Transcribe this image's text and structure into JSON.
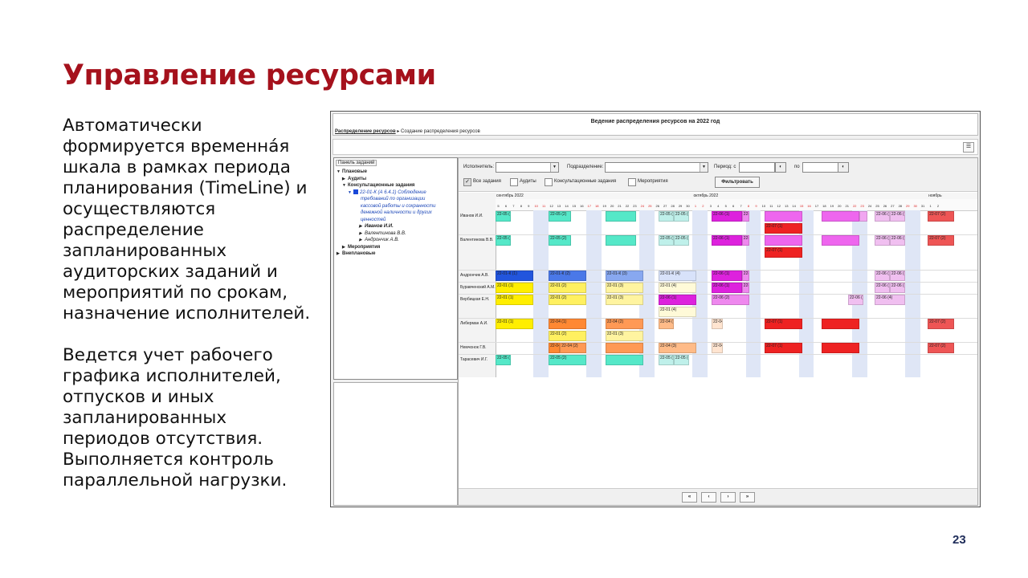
{
  "slide": {
    "title": "Управление ресурсами",
    "para1": [
      "Автоматически",
      "формируется временна́я",
      "шкала в рамках периода",
      "планирования (TimeLine) и",
      "осуществляются",
      "распределение",
      "запланированных",
      "аудиторских заданий и",
      "мероприятий по срокам,",
      "назначение исполнителей."
    ],
    "para2": [
      "Ведется учет рабочего",
      "графика исполнителей,",
      "отпусков и иных",
      "запланированных",
      "периодов отсутствия.",
      "Выполняется контроль",
      "параллельной нагрузки."
    ],
    "page_number": "23"
  },
  "app": {
    "title": "Ведение распределения ресурсов на 2022 год",
    "breadcrumb_link": "Распределение ресурсов",
    "breadcrumb_sep": "▸",
    "breadcrumb_current": "Создание распределения ресурсов",
    "menu_icon": "list-icon"
  },
  "tree": {
    "header": "Панель заданий",
    "planned": "Плановые",
    "audits": "Аудиты",
    "consult": "Консультационные задания",
    "task_lines": [
      "22-01-К (А 6.4.1) Соблюдение",
      "требований по организации",
      "кассовой работы и сохранности",
      "денежной наличности и других",
      "ценностей"
    ],
    "people": [
      "Иванов И.И.",
      "Валентинова В.В.",
      "Андрончик А.В."
    ],
    "events": "Мероприятия",
    "unplanned": "Внеплановые"
  },
  "filters": {
    "executor_label": "Исполнитель:",
    "dept_label": "Подразделение:",
    "period_from_label": "Период: с",
    "period_to_label": "по",
    "checkboxes": [
      "Все задания",
      "Аудиты",
      "Консультационные задания",
      "Мероприятия"
    ],
    "all_checked": "✓",
    "filter_button": "Фильтровать"
  },
  "timeline": {
    "months": [
      "сентябрь 2022",
      "октябрь 2022",
      "ноябрь"
    ],
    "day_numbers": [
      "5",
      "6",
      "7",
      "8",
      "9",
      "10",
      "11",
      "12",
      "13",
      "14",
      "15",
      "16",
      "17",
      "18",
      "19",
      "20",
      "21",
      "22",
      "23",
      "24",
      "25",
      "26",
      "27",
      "28",
      "29",
      "30",
      "1",
      "2",
      "3",
      "4",
      "5",
      "6",
      "7",
      "8",
      "9",
      "10",
      "11",
      "12",
      "13",
      "14",
      "15",
      "16",
      "17",
      "18",
      "19",
      "20",
      "21",
      "22",
      "23",
      "24",
      "25",
      "26",
      "27",
      "28",
      "29",
      "30",
      "31",
      "1",
      "2"
    ],
    "rows": [
      {
        "name": "Иванов И.И.",
        "bars": [
          [
            "22-05 (1)",
            "#55e8c8",
            0,
            4
          ],
          [
            "22-05 (2)",
            "#55e8c8",
            14,
            20
          ],
          [
            "",
            "#55e8c8",
            29,
            37
          ],
          [
            "22-05 (3)",
            "#bff0ea",
            43,
            47
          ],
          [
            "22-05 (4)",
            "#bff0ea",
            47,
            51
          ],
          [
            "22-06 (1)",
            "#dd22dd",
            57,
            65
          ],
          [
            "22-0",
            "#ee88ee",
            65,
            67
          ],
          [
            "",
            "#ee66ee",
            71,
            81
          ],
          [
            "",
            "#ee66ee",
            86,
            96
          ],
          [
            "",
            "#f1a6f1",
            96,
            98
          ],
          [
            "22-06 (3)",
            "#f0bff0",
            100,
            104
          ],
          [
            "22-06 (4)",
            "#f0bff0",
            104,
            108
          ],
          [
            "22-07 (2)",
            "#ee5555",
            114,
            121
          ]
        ]
      },
      {
        "name": "",
        "bars": [
          [
            "22-07 (1)",
            "#ee2222",
            71,
            81
          ]
        ]
      },
      {
        "name": "Валентинова В.В.",
        "bars": [
          [
            "22-05 (1)",
            "#55e8c8",
            0,
            4
          ],
          [
            "22-05 (2)",
            "#55e8c8",
            14,
            20
          ],
          [
            "",
            "#55e8c8",
            29,
            37
          ],
          [
            "22-05 (3)",
            "#bff0ea",
            43,
            47
          ],
          [
            "22-05 (4)",
            "#bff0ea",
            47,
            51
          ],
          [
            "22-06 (1)",
            "#dd22dd",
            57,
            65
          ],
          [
            "22-0",
            "#ee88ee",
            65,
            67
          ],
          [
            "",
            "#ee66ee",
            71,
            81
          ],
          [
            "",
            "#ee66ee",
            86,
            96
          ],
          [
            "22-06 (3)",
            "#f0bff0",
            100,
            104
          ],
          [
            "22-06 (4)",
            "#f0bff0",
            104,
            108
          ],
          [
            "22-07 (2)",
            "#ee5555",
            114,
            121
          ]
        ]
      },
      {
        "name": "",
        "bars": [
          [
            "22-07 (1)",
            "#ee2222",
            71,
            81
          ]
        ]
      },
      {
        "name": "Андрончик А.В.",
        "bars": [
          [
            "22-01-К (1)",
            "#2255dd",
            0,
            10
          ],
          [
            "22-01-К (2)",
            "#4a78e8",
            14,
            24
          ],
          [
            "22-01-К (3)",
            "#88a8f0",
            29,
            39
          ],
          [
            "22-01-К (4)",
            "#d8e2fa",
            43,
            53
          ],
          [
            "22-06 (1)",
            "#dd22dd",
            57,
            65
          ],
          [
            "22-0",
            "#ee88ee",
            65,
            67
          ],
          [
            "22-06 (3)",
            "#f0bff0",
            100,
            104
          ],
          [
            "22-06 (4)",
            "#f0bff0",
            104,
            108
          ]
        ]
      },
      {
        "name": "Буравченский А.М.",
        "bars": [
          [
            "22-01 (1)",
            "#ffee00",
            0,
            10
          ],
          [
            "22-01 (2)",
            "#fff060",
            14,
            24
          ],
          [
            "22-01 (3)",
            "#fff4a0",
            29,
            39
          ],
          [
            "22-01 (4)",
            "#fffad8",
            43,
            53
          ],
          [
            "22-06 (1)",
            "#dd22dd",
            57,
            65
          ],
          [
            "22-0",
            "#ee88ee",
            65,
            67
          ],
          [
            "22-06 (3)",
            "#f0bff0",
            100,
            104
          ],
          [
            "22-06 (4)",
            "#f0bff0",
            104,
            108
          ]
        ]
      },
      {
        "name": "Вербицкая Е.Н.",
        "bars": [
          [
            "22-01 (1)",
            "#ffee00",
            0,
            10
          ],
          [
            "22-01 (2)",
            "#fff060",
            14,
            24
          ],
          [
            "22-01 (3)",
            "#fff4a0",
            29,
            39
          ],
          [
            "22-06 (1)",
            "#dd22dd",
            43,
            53
          ],
          [
            "22-06 (2)",
            "#ee88ee",
            57,
            67
          ],
          [
            "22-06 (3)",
            "#f0bff0",
            93,
            97
          ],
          [
            "22-06 (4)",
            "#f0bff0",
            100,
            108
          ]
        ]
      },
      {
        "name": "",
        "bars": [
          [
            "22-01 (4)",
            "#fffad8",
            43,
            53
          ]
        ]
      },
      {
        "name": "Либерман А.И.",
        "bars": [
          [
            "22-01 (1)",
            "#ffee00",
            0,
            10
          ],
          [
            "22-04 (1)",
            "#ff8833",
            14,
            24
          ],
          [
            "22-04 (2)",
            "#ff9955",
            29,
            39
          ],
          [
            "22-04 (3)",
            "#ffbb88",
            43,
            47
          ],
          [
            "22-04 (4)",
            "#ffe4d0",
            57,
            60
          ],
          [
            "22-07 (1)",
            "#ee2222",
            71,
            81
          ],
          [
            "",
            "#ee2222",
            86,
            96
          ],
          [
            "22-07 (2)",
            "#ee5555",
            114,
            121
          ]
        ]
      },
      {
        "name": "",
        "bars": [
          [
            "22-01 (2)",
            "#fff060",
            14,
            24
          ],
          [
            "22-01 (3)",
            "#fff4a0",
            29,
            39
          ]
        ]
      },
      {
        "name": "Немчонок Г.В.",
        "bars": [
          [
            "22-04 (1)",
            "#ff8833",
            14,
            17
          ],
          [
            "22-04 (2)",
            "#ff9955",
            17,
            24
          ],
          [
            "",
            "#ff9955",
            29,
            39
          ],
          [
            "22-04 (3)",
            "#ffbb88",
            43,
            53
          ],
          [
            "22-04 (4)",
            "#ffe4d0",
            57,
            60
          ],
          [
            "22-07 (1)",
            "#ee2222",
            71,
            81
          ],
          [
            "",
            "#ee2222",
            86,
            96
          ],
          [
            "22-07 (2)",
            "#ee5555",
            114,
            121
          ]
        ]
      },
      {
        "name": "Тарасевич И.Г.",
        "bars": [
          [
            "22-05 (1)",
            "#55e8c8",
            0,
            4
          ],
          [
            "22-05 (2)",
            "#55e8c8",
            14,
            24
          ],
          [
            "",
            "#55e8c8",
            29,
            39
          ],
          [
            "22-05 (3)",
            "#bff0ea",
            43,
            47
          ],
          [
            "22-05 (4)",
            "#bff0ea",
            47,
            51
          ]
        ]
      }
    ]
  },
  "pager": [
    "«",
    "‹",
    "›",
    "»"
  ]
}
